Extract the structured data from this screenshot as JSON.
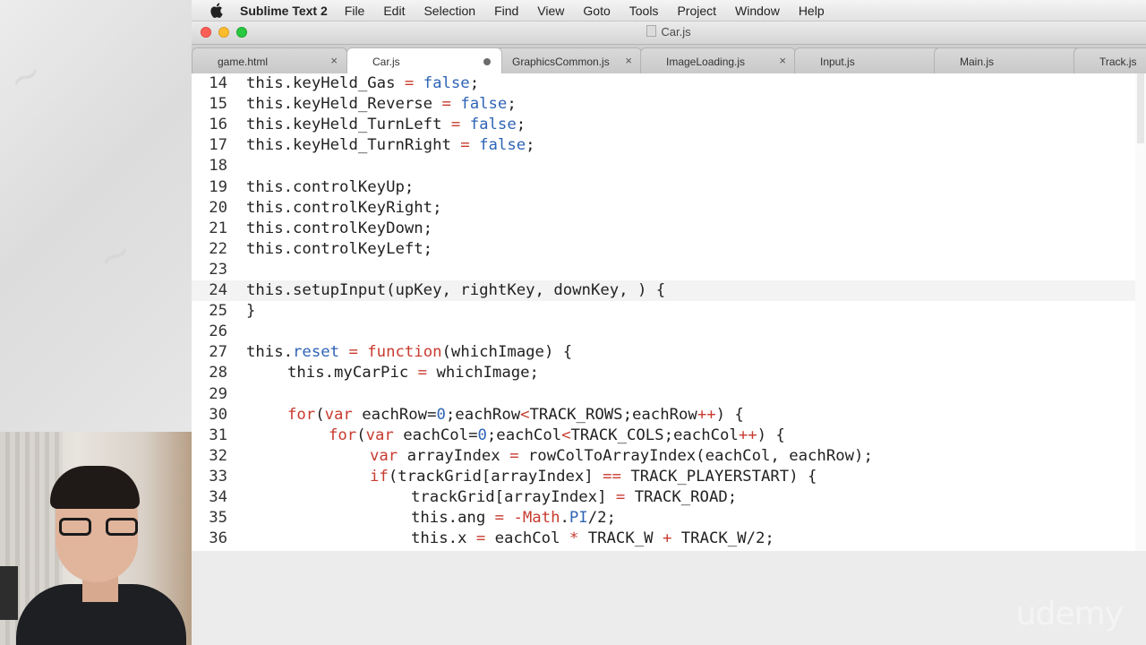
{
  "menubar": {
    "app_name": "Sublime Text 2",
    "items": [
      "File",
      "Edit",
      "Selection",
      "Find",
      "View",
      "Goto",
      "Tools",
      "Project",
      "Window",
      "Help"
    ]
  },
  "window": {
    "title": "Car.js"
  },
  "tabs": [
    {
      "label": "game.html",
      "close": "×"
    },
    {
      "label": "Car.js",
      "close": ""
    },
    {
      "label": "GraphicsCommon.js",
      "close": "×"
    },
    {
      "label": "ImageLoading.js",
      "close": "×"
    },
    {
      "label": "Input.js",
      "close": "×"
    },
    {
      "label": "Main.js",
      "close": "×"
    },
    {
      "label": "Track.js",
      "close": ""
    }
  ],
  "editor": {
    "lines": [
      {
        "num": "14",
        "text": "this.keyHeld_Gas = false;"
      },
      {
        "num": "15",
        "text": "this.keyHeld_Reverse = false;"
      },
      {
        "num": "16",
        "text": "this.keyHeld_TurnLeft = false;"
      },
      {
        "num": "17",
        "text": "this.keyHeld_TurnRight = false;"
      },
      {
        "num": "18",
        "text": ""
      },
      {
        "num": "19",
        "text": "this.controlKeyUp;"
      },
      {
        "num": "20",
        "text": "this.controlKeyRight;"
      },
      {
        "num": "21",
        "text": "this.controlKeyDown;"
      },
      {
        "num": "22",
        "text": "this.controlKeyLeft;"
      },
      {
        "num": "23",
        "text": ""
      },
      {
        "num": "24",
        "text": "this.setupInput(upKey, rightKey, downKey, ) {"
      },
      {
        "num": "25",
        "text": "}"
      },
      {
        "num": "26",
        "text": ""
      },
      {
        "num": "27",
        "text": "this.reset = function(whichImage) {"
      },
      {
        "num": "28",
        "text": "this.myCarPic = whichImage;"
      },
      {
        "num": "29",
        "text": ""
      },
      {
        "num": "30",
        "text": "for(var eachRow=0;eachRow<TRACK_ROWS;eachRow++) {"
      },
      {
        "num": "31",
        "text": "for(var eachCol=0;eachCol<TRACK_COLS;eachCol++) {"
      },
      {
        "num": "32",
        "text": "var arrayIndex = rowColToArrayIndex(eachCol, eachRow);"
      },
      {
        "num": "33",
        "text": "if(trackGrid[arrayIndex] == TRACK_PLAYERSTART) {"
      },
      {
        "num": "34",
        "text": "trackGrid[arrayIndex] = TRACK_ROAD;"
      },
      {
        "num": "35",
        "text": "this.ang = -Math.PI/2;"
      },
      {
        "num": "36",
        "text": "this.x = eachCol * TRACK_W + TRACK_W/2;"
      }
    ]
  },
  "watermark": "udemy"
}
